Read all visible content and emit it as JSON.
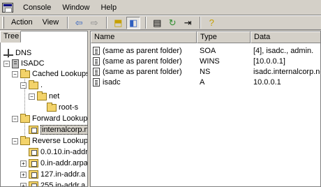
{
  "menubar": {
    "items": [
      "Console",
      "Window",
      "Help"
    ]
  },
  "toolbar": {
    "action_label": "Action",
    "view_label": "View"
  },
  "tree_tab": {
    "label": "Tree"
  },
  "tree": {
    "dns": "DNS",
    "server": "ISADC",
    "cached_lookups": "Cached Lookups",
    "dot": ".",
    "net": "net",
    "root_servers": "root-s",
    "forward_lookup": "Forward Lookup Z",
    "internalcorp": "internalcorp.n",
    "reverse_lookup": "Reverse Lookup Z",
    "rev1": "0.0.10.in-addr",
    "rev2": "0.in-addr.arpa",
    "rev3": "127.in-addr.a",
    "rev4": "255.in-addr.a"
  },
  "list": {
    "columns": [
      "Name",
      "Type",
      "Data"
    ],
    "rows": [
      {
        "name": "(same as parent folder)",
        "type": "SOA",
        "data": "[4], isadc., admin."
      },
      {
        "name": "(same as parent folder)",
        "type": "WINS",
        "data": "[10.0.0.1]"
      },
      {
        "name": "(same as parent folder)",
        "type": "NS",
        "data": "isadc.internalcorp.net."
      },
      {
        "name": "isadc",
        "type": "A",
        "data": "10.0.0.1"
      }
    ]
  },
  "icons": {
    "back": "back-arrow-icon",
    "forward": "forward-arrow-icon",
    "up": "up-folder-icon",
    "show_tree": "show-hide-tree-icon",
    "properties": "properties-icon",
    "refresh": "refresh-icon",
    "export": "export-list-icon",
    "help": "help-icon"
  }
}
